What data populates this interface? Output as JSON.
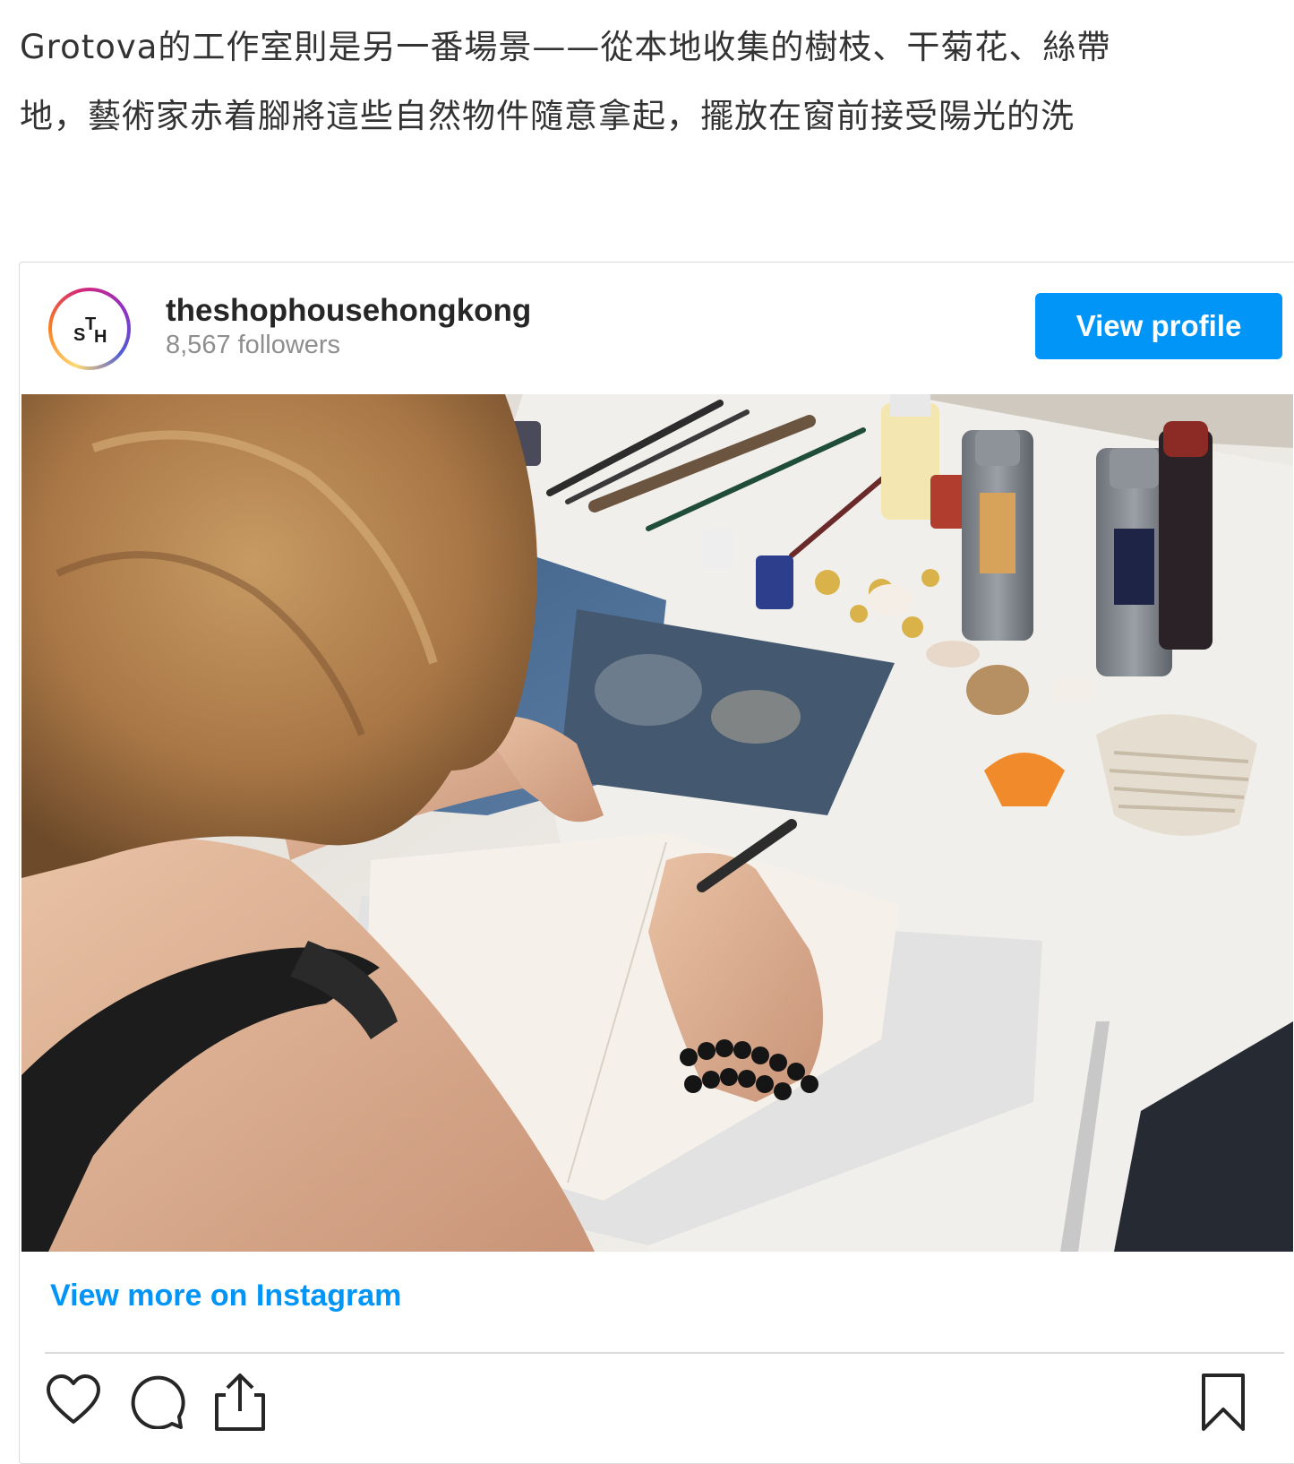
{
  "article": {
    "line1": "Grotova的工作室則是另一番場景——從本地收集的樹枝、干菊花、絲帶",
    "line2": "地，藝術家赤着腳將這些自然物件隨意拿起，擺放在窗前接受陽光的洗"
  },
  "instagram": {
    "avatar": {
      "letters": [
        "S",
        "T",
        "H"
      ]
    },
    "username": "theshophousehongkong",
    "followers": "8,567 followers",
    "view_profile_label": "View profile",
    "view_more_label": "View more on Instagram",
    "actions": [
      "heart-icon",
      "comment-icon",
      "share-icon",
      "bookmark-icon"
    ]
  },
  "colors": {
    "accent": "#0095f6",
    "border": "#dbdbdb",
    "muted": "#8e8e8e",
    "text": "#262626"
  }
}
